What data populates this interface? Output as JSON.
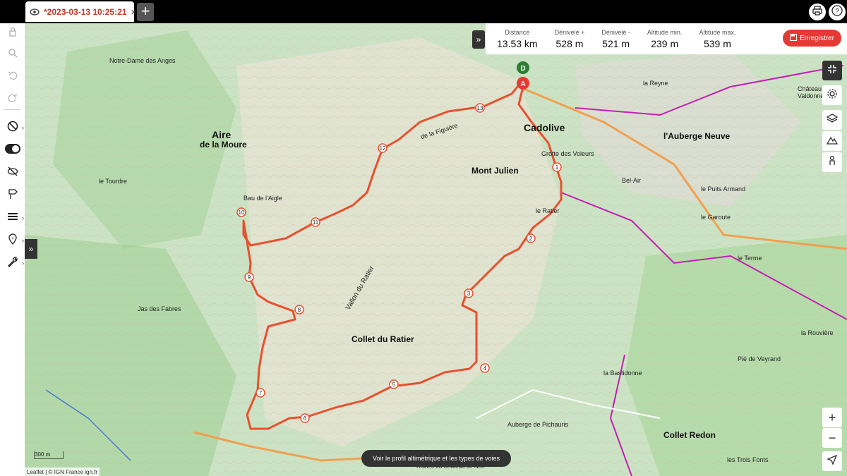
{
  "tab": {
    "title": "*2023-03-13 10:25:21",
    "close": "×",
    "new": "+"
  },
  "stats": {
    "distance_label": "Distance",
    "distance_value": "13.53 km",
    "dplus_label": "Dénivelé +",
    "dplus_value": "528 m",
    "dminus_label": "Dénivelé -",
    "dminus_value": "521 m",
    "altmin_label": "Altitude min.",
    "altmin_value": "239 m",
    "altmax_label": "Altitude max.",
    "altmax_value": "539 m",
    "save_label": "Enregistrer"
  },
  "map": {
    "labels": {
      "cadolive": "Cadolive",
      "mont_julien": "Mont Julien",
      "aire": "Aire",
      "de_la_moure": "de la Moure",
      "collet_ratier": "Collet du Ratier",
      "vallon_ratier": "Vallon du Ratier",
      "notre_dame": "Notre-Dame des Anges",
      "auberge_neuve": "l'Auberge Neuve",
      "bel_air": "Bel-Air",
      "puits_armand": "le Puits Armand",
      "la_bastidonne": "la Bastidonne",
      "pie_veyrand": "Pié de Veyrand",
      "collet_redon": "Collet Redon",
      "trois_fonts": "les Trois Fonts",
      "la_rouviere": "la Rouvière",
      "le_terme": "le Terme",
      "le_tourdre": "le Tourdre",
      "le_ratier": "le Ratier",
      "auberge_pichauris": "Auberge de Pichauris",
      "grotte_voleurs": "Grotte des Voleurs",
      "figuiere": "de la Figuière",
      "la_reynie": "la Reyne",
      "jas_fabres": "Jas des Fabres",
      "garoute": "le Garoute",
      "chateau_valdonne": "Château de Valdonne",
      "bau_aigle": "Bau de l'Aigle",
      "ruines": "Ruines du Château de Nerf"
    },
    "markers": {
      "depart": "D",
      "arrivee": "A"
    },
    "waypoints": [
      "1",
      "2",
      "3",
      "4",
      "5",
      "6",
      "7",
      "8",
      "9",
      "10",
      "11",
      "12",
      "13"
    ],
    "scale": "300 m",
    "attribution": "Leaflet | © IGN France ign.fr",
    "route_color": "#e8502e",
    "profile_button": "Voir le profil altimétrique et les types de voies"
  },
  "controls": {
    "zoom_in": "+",
    "zoom_out": "−"
  }
}
